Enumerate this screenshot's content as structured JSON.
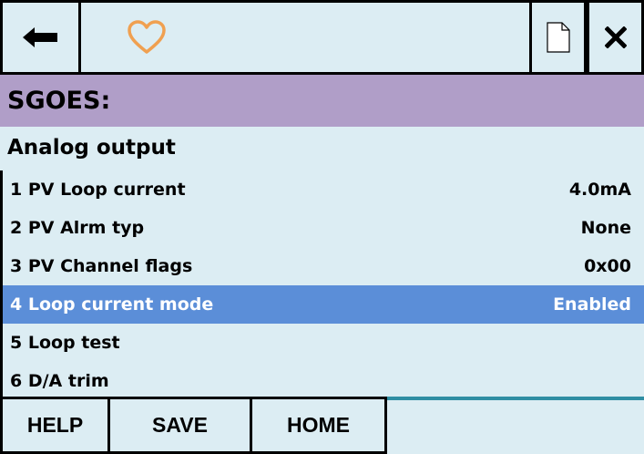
{
  "toolbar": {
    "back_icon": "arrow-left-icon",
    "favorite_icon": "heart-outline-icon",
    "document_icon": "document-icon",
    "close_icon": "close-icon",
    "favorite_color": "#f0a050"
  },
  "device_title": "SGOES:",
  "menu_title": "Analog output",
  "rows": [
    {
      "label": "1 PV Loop current",
      "value": "4.0mA"
    },
    {
      "label": "2 PV Alrm typ",
      "value": "None"
    },
    {
      "label": "3 PV Channel flags",
      "value": "0x00"
    },
    {
      "label": "4 Loop current mode",
      "value": "Enabled",
      "selected": true
    },
    {
      "label": "5 Loop test",
      "value": ""
    },
    {
      "label": "6 D/A trim",
      "value": ""
    }
  ],
  "buttons": {
    "help": "HELP",
    "save": "SAVE",
    "home": "HOME"
  },
  "colors": {
    "background": "#dcedf3",
    "title_bar": "#b09ec8",
    "selected_row": "#5b8ed8",
    "accent_line": "#2f8ea3"
  }
}
